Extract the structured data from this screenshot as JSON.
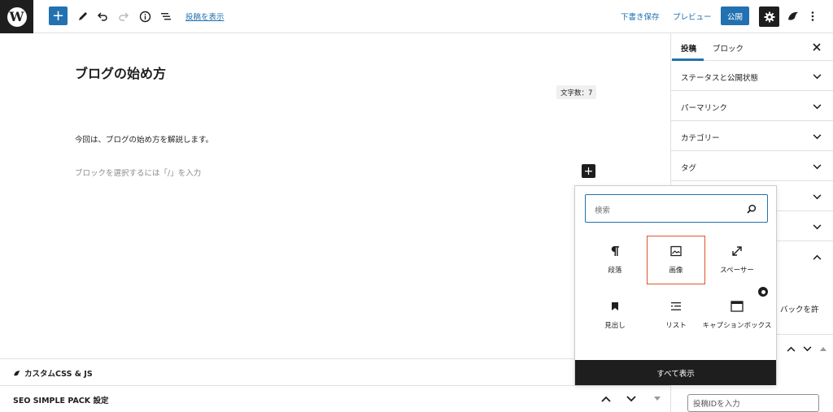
{
  "topbar": {
    "logo_letter": "W",
    "add_symbol": "+",
    "view_post_link": "投稿を表示",
    "save_draft": "下書き保存",
    "preview": "プレビュー",
    "publish": "公開",
    "accent": "#2271b1"
  },
  "editor": {
    "title": "ブログの始め方",
    "word_count": "文字数：7",
    "paragraph": "今回は、ブログの始め方を解説します。",
    "placeholder": "ブロックを選択するには「/」を入力",
    "add_symbol": "+"
  },
  "inserter": {
    "search_placeholder": "検索",
    "blocks": [
      {
        "label": "段落",
        "icon": "paragraph-icon"
      },
      {
        "label": "画像",
        "icon": "image-icon",
        "highlighted": true
      },
      {
        "label": "スペーサー",
        "icon": "spacer-icon"
      },
      {
        "label": "見出し",
        "icon": "bookmark-icon"
      },
      {
        "label": "リスト",
        "icon": "list-icon"
      },
      {
        "label": "キャプションボックス",
        "icon": "caption-box-icon"
      }
    ],
    "show_all": "すべて表示",
    "highlight_color": "#e0542c"
  },
  "sidebar": {
    "tabs": [
      "投稿",
      "ブロック"
    ],
    "panels": [
      "ステータスと公開状態",
      "パーマリンク",
      "カテゴリー",
      "タグ"
    ],
    "partial_text": "バックを許",
    "post_id_placeholder": "投稿IDを入力"
  },
  "metaboxes": [
    {
      "title": "カスタムCSS & JS"
    },
    {
      "title": "SEO SIMPLE PACK 設定"
    }
  ]
}
